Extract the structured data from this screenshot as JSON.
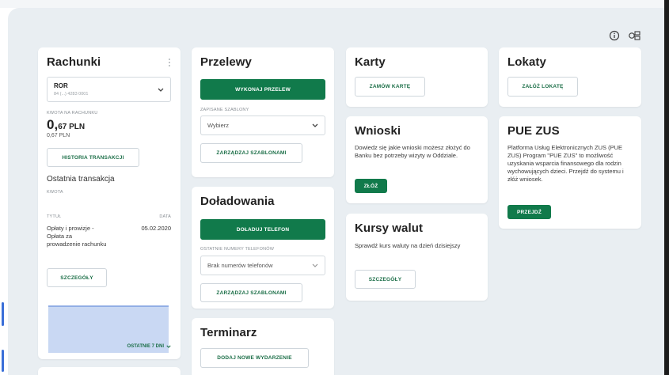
{
  "rachunki": {
    "title": "Rachunki",
    "account_type": "ROR",
    "account_number": "84 (...) 4283 0001",
    "balance_label": "KWOTA NA RACHUNKU",
    "balance_int": "0,",
    "balance_dec": "67 PLN",
    "balance_sub": "0,67 PLN",
    "history_button": "HISTORIA TRANSAKCJI",
    "last_transaction_title": "Ostatnia transakcja",
    "amount_label": "KWOTA",
    "col_title": "TYTUŁ",
    "col_date": "DATA",
    "tx_title": "Opłaty i prowizje - Opłata za prowadzenie rachunku",
    "tx_date": "05.02.2020",
    "details_button": "SZCZEGÓŁY",
    "range_selector": "OSTATNIE 7 DNI"
  },
  "przelewy": {
    "title": "Przelewy",
    "execute_button": "WYKONAJ PRZELEW",
    "templates_label": "ZAPISANE SZABLONY",
    "templates_select": "Wybierz",
    "manage_button": "ZARZĄDZAJ SZABLONAMI"
  },
  "doladowania": {
    "title": "Doładowania",
    "topup_button": "DOŁADUJ TELEFON",
    "recent_label": "OSTATNIE NUMERY TELEFONÓW",
    "recent_select": "Brak numerów telefonów",
    "manage_button": "ZARZĄDZAJ SZABLONAMI"
  },
  "terminarz": {
    "title": "Terminarz",
    "add_button": "DODAJ NOWE WYDARZENIE"
  },
  "karty": {
    "title": "Karty",
    "order_button": "ZAMÓW KARTĘ"
  },
  "wnioski": {
    "title": "Wnioski",
    "text": "Dowiedz się jakie wnioski możesz złożyć do Banku bez potrzeby wizyty w Oddziale.",
    "submit_button": "ZŁÓŻ"
  },
  "kursy": {
    "title": "Kursy walut",
    "text": "Sprawdź kurs waluty na dzień dzisiejszy",
    "details_button": "SZCZEGÓŁY"
  },
  "lokaty": {
    "title": "Lokaty",
    "open_button": "ZAŁÓŻ LOKATĘ"
  },
  "pue": {
    "title": "PUE ZUS",
    "text": "Platforma Usług Elektronicznych ZUS (PUE ZUS) Program \"PUE ZUS\" to możliwość uzyskania wsparcia finansowego dla rodzin wychowujących dzieci. Przejdź do systemu i złóż wniosek.",
    "go_button": "PRZEJDŹ"
  },
  "icons": {
    "info": "info-icon",
    "settings": "layout-settings-icon",
    "kebab": "kebab-menu-icon",
    "chevron": "chevron-down-icon"
  },
  "colors": {
    "primary": "#117a4b",
    "background": "#e9eef2",
    "chart_fill": "#c5d5f2",
    "chart_line": "#7d9ddf"
  }
}
